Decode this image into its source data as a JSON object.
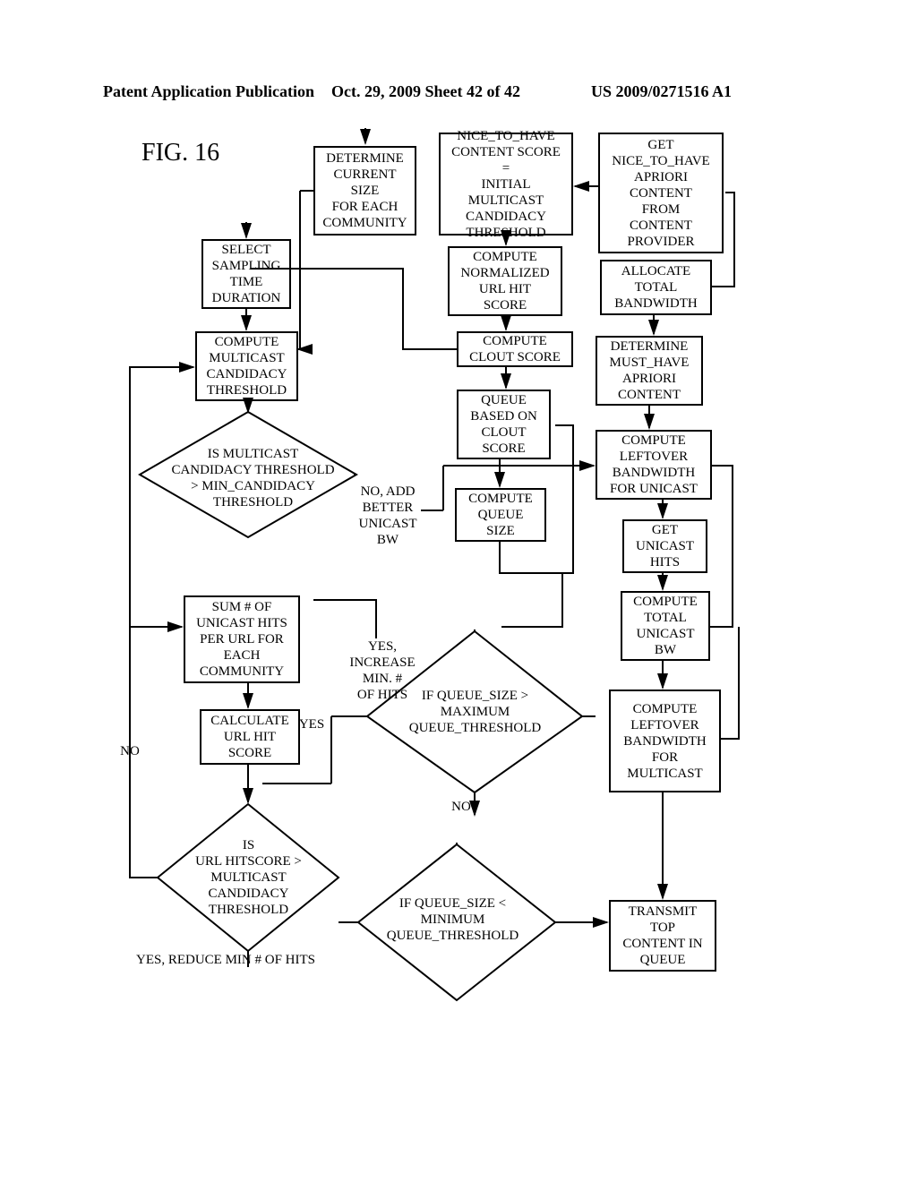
{
  "header": {
    "left": "Patent Application Publication",
    "center": "Oct. 29, 2009  Sheet 42 of 42",
    "right": "US 2009/0271516 A1"
  },
  "figure_label": "FIG. 16",
  "boxes": {
    "determine_size": "DETERMINE\nCURRENT\nSIZE\nFOR EACH\nCOMMUNITY",
    "select_sampling": "SELECT\nSAMPLING\nTIME\nDURATION",
    "compute_multicast": "COMPUTE\nMULTICAST\nCANDIDACY\nTHRESHOLD",
    "sum_hits": "SUM # OF\nUNICAST HITS\nPER URL FOR\nEACH\nCOMMUNITY",
    "calc_url_score": "CALCULATE\nURL HIT\nSCORE",
    "nice_to_have_score": "NICE_TO_HAVE\nCONTENT SCORE =\nINITIAL\nMULTICAST\nCANDIDACY\nTHRESHOLD",
    "compute_norm": "COMPUTE\nNORMALIZED\nURL HIT\nSCORE",
    "compute_clout": "COMPUTE\nCLOUT SCORE",
    "queue_clout": "QUEUE\nBASED ON\nCLOUT\nSCORE",
    "compute_queue_size": "COMPUTE\nQUEUE\nSIZE",
    "get_nice": "GET\nNICE_TO_HAVE\nAPRIORI\nCONTENT\nFROM\nCONTENT\nPROVIDER",
    "allocate_bw": "ALLOCATE\nTOTAL\nBANDWIDTH",
    "determine_must": "DETERMINE\nMUST_HAVE\nAPRIORI\nCONTENT",
    "compute_leftover_unicast": "COMPUTE\nLEFTOVER\nBANDWIDTH\nFOR UNICAST",
    "get_unicast_hits": "GET\nUNICAST\nHITS",
    "compute_total_unicast": "COMPUTE\nTOTAL\nUNICAST\nBW",
    "compute_leftover_multicast": "COMPUTE\nLEFTOVER\nBANDWIDTH\nFOR\nMULTICAST",
    "transmit_top": "TRANSMIT\nTOP\nCONTENT IN\nQUEUE"
  },
  "diamonds": {
    "is_multicast": "IS MULTICAST\nCANDIDACY THRESHOLD\n> MIN_CANDIDACY\nTHRESHOLD",
    "queue_max": "IF QUEUE_SIZE >\nMAXIMUM\nQUEUE_THRESHOLD",
    "is_url_hitscore": "IS\nURL HITSCORE >\nMULTICAST\nCANDIDACY\nTHRESHOLD",
    "queue_min": "IF QUEUE_SIZE <\nMINIMUM\nQUEUE_THRESHOLD"
  },
  "labels": {
    "no_add_better": "NO, ADD\nBETTER\nUNICAST\nBW",
    "yes_increase": "YES,\nINCREASE\nMIN. #\nOF HITS",
    "yes_left": "YES",
    "no_left": "NO",
    "no_mid": "NO",
    "yes_reduce": "YES, REDUCE MIN # OF HITS"
  }
}
